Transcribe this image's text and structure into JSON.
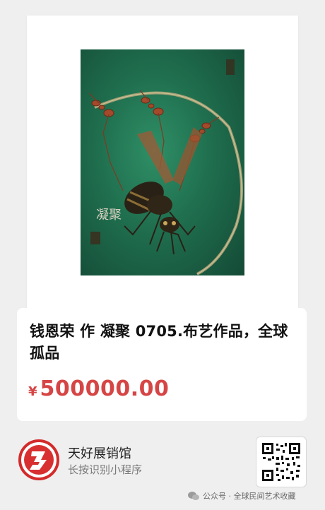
{
  "product": {
    "title": "钱恩荣 作 凝聚 0705.布艺作品，全球孤品",
    "price_symbol": "¥",
    "price": "500000.00",
    "price_color": "#d64545"
  },
  "artwork": {
    "icon": "artwork-image",
    "inscription": "凝聚"
  },
  "miniprogram": {
    "name": "天好展销馆",
    "hint": "长按识别小程序",
    "logo_icon": "app-logo-icon",
    "qr_icon": "qr-code-icon"
  },
  "watermark": {
    "text": "公众号 · 全球民间艺术收藏",
    "icon": "wechat-icon"
  }
}
